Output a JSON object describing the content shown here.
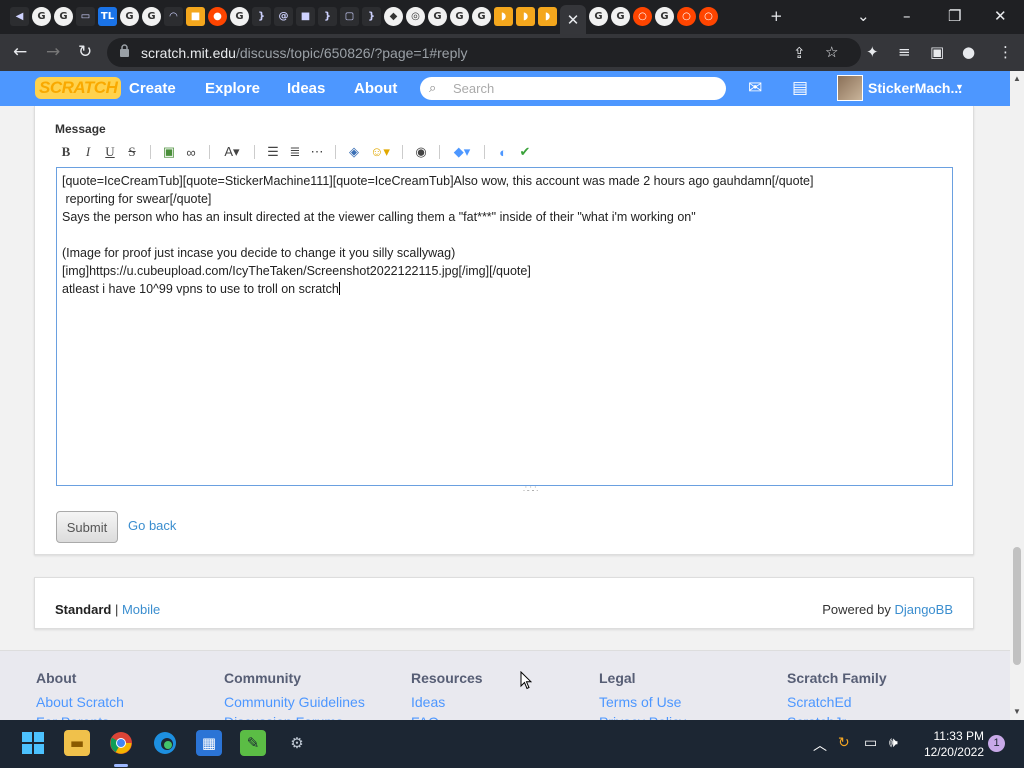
{
  "browser": {
    "url_host": "scratch.mit.edu",
    "url_path": "/discuss/topic/650826/?page=1#reply",
    "tab_icons": [
      "mute",
      "google",
      "google",
      "screen",
      "TL",
      "google",
      "google",
      "wifi",
      "orange",
      "reddit",
      "google",
      "brackets",
      "at",
      "dark",
      "brackets",
      "chat",
      "brackets",
      "roblox",
      "chrome",
      "google",
      "google",
      "google",
      "bean",
      "bean",
      "bean",
      "active",
      "google",
      "google",
      "record",
      "google",
      "record",
      "record"
    ]
  },
  "nav": {
    "logo": "SCRATCH",
    "create": "Create",
    "explore": "Explore",
    "ideas": "Ideas",
    "about": "About",
    "search_placeholder": "Search",
    "username": "StickerMach..."
  },
  "form": {
    "message_label": "Message",
    "lines": [
      "[quote=IceCreamTub][quote=StickerMachine111][quote=IceCreamTub]Also wow, this account was made 2 hours ago gauhdamn[/quote]",
      " reporting for swear[/quote]",
      "Says the person who has an insult directed at the viewer calling them a \"fat***\" inside of their \"what i'm working on\"",
      "",
      "(Image for proof just incase you decide to change it you silly scallywag)",
      "[img]https://u.cubeupload.com/IcyTheTaken/Screenshot2022122115.jpg[/img][/quote]",
      "atleast i have 10^99 vpns to use to troll on scratch"
    ],
    "submit": "Submit",
    "go_back": "Go back"
  },
  "footer_bar": {
    "standard": "Standard",
    "separator": " | ",
    "mobile": "Mobile",
    "powered_by": "Powered by ",
    "djangobb": "DjangoBB"
  },
  "site_footer": {
    "columns": [
      {
        "title": "About",
        "links": [
          "About Scratch",
          "For Parents"
        ]
      },
      {
        "title": "Community",
        "links": [
          "Community Guidelines",
          "Discussion Forums"
        ]
      },
      {
        "title": "Resources",
        "links": [
          "Ideas",
          "FAQ"
        ]
      },
      {
        "title": "Legal",
        "links": [
          "Terms of Use",
          "Privacy Policy"
        ]
      },
      {
        "title": "Scratch Family",
        "links": [
          "ScratchEd",
          "ScratchJr"
        ]
      }
    ]
  },
  "taskbar": {
    "time": "11:33 PM",
    "date": "12/20/2022",
    "notifications": "1"
  }
}
